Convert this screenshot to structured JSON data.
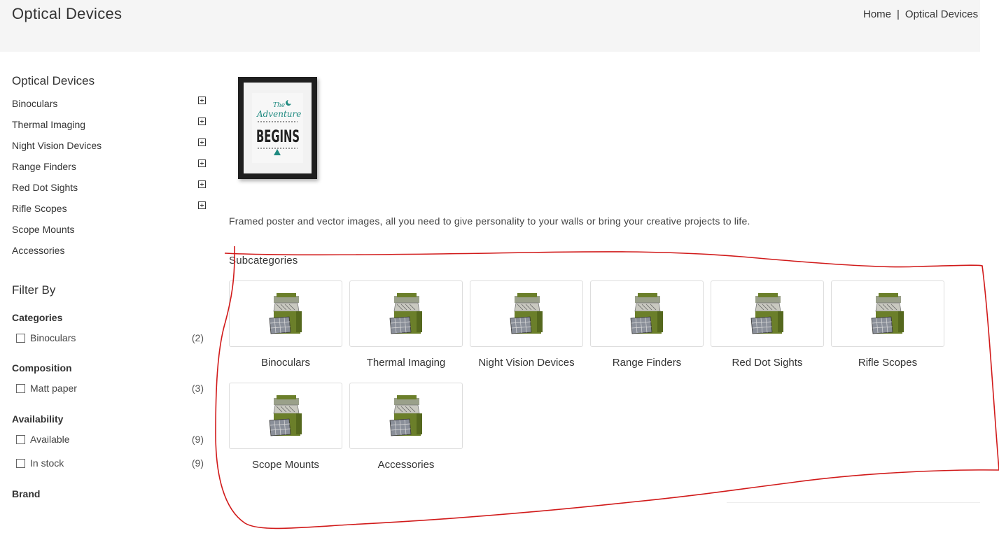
{
  "header": {
    "title": "Optical Devices",
    "breadcrumb": {
      "home": "Home",
      "separator": "|",
      "current": "Optical Devices"
    }
  },
  "sidebar": {
    "title": "Optical Devices",
    "categories": [
      {
        "label": "Binoculars",
        "expandable": true
      },
      {
        "label": "Thermal Imaging",
        "expandable": true
      },
      {
        "label": "Night Vision Devices",
        "expandable": true
      },
      {
        "label": "Range Finders",
        "expandable": true
      },
      {
        "label": "Red Dot Sights",
        "expandable": true
      },
      {
        "label": "Rifle Scopes",
        "expandable": true
      },
      {
        "label": "Scope Mounts",
        "expandable": false
      },
      {
        "label": "Accessories",
        "expandable": false
      }
    ],
    "filter": {
      "title": "Filter By",
      "facets": [
        {
          "title": "Categories",
          "options": [
            {
              "label": "Binoculars",
              "count": "(2)"
            }
          ]
        },
        {
          "title": "Composition",
          "options": [
            {
              "label": "Matt paper",
              "count": "(3)"
            }
          ]
        },
        {
          "title": "Availability",
          "options": [
            {
              "label": "Available",
              "count": "(9)"
            },
            {
              "label": "In stock",
              "count": "(9)"
            }
          ]
        },
        {
          "title": "Brand",
          "options": []
        }
      ]
    }
  },
  "main": {
    "poster": {
      "line1": "The",
      "line2": "Adventure",
      "line3": "BEGINS"
    },
    "description": "Framed poster and vector images, all you need to give personality to your walls or bring your creative projects to life.",
    "subcategories_heading": "Subcategories",
    "subcategories": [
      {
        "label": "Binoculars"
      },
      {
        "label": "Thermal Imaging"
      },
      {
        "label": "Night Vision Devices"
      },
      {
        "label": "Range Finders"
      },
      {
        "label": "Red Dot Sights"
      },
      {
        "label": "Rifle Scopes"
      },
      {
        "label": "Scope Mounts"
      },
      {
        "label": "Accessories"
      }
    ]
  },
  "colors": {
    "header_bg": "#f5f5f5",
    "text": "#333333",
    "poster_teal": "#1f8a80",
    "thumb_green": "#6b7f2a",
    "annotation_red": "#d11a1a"
  }
}
